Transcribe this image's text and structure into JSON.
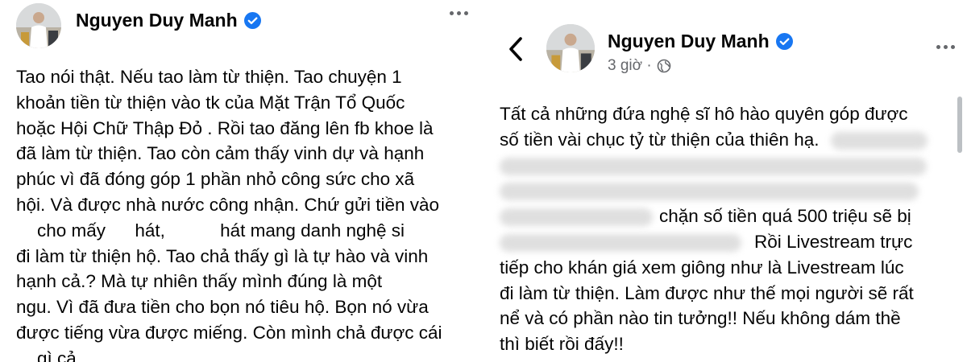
{
  "colors": {
    "verified_blue": "#1877f2",
    "text": "#050505",
    "muted": "#65676b",
    "blur_gray": "#dcdcdc"
  },
  "left_post": {
    "author": "Nguyen Duy Manh",
    "icons": {
      "verified": "verified-badge-icon",
      "more": "more-options-icon"
    },
    "lines": [
      [
        "Tao nói thật. Nếu tao làm từ thiện. Tao chuyện 1"
      ],
      [
        "khoản tiền từ thiện vào tk của Mặt Trận Tổ Quốc"
      ],
      [
        "hoặc Hội Chữ Thập Đỏ . Rồi tao đăng lên fb khoe là"
      ],
      [
        "đã làm từ thiện. Tao còn cảm thấy vinh dự và hạnh"
      ],
      [
        "phúc vì đã đóng góp 1 phần nhỏ công sức cho xã"
      ],
      [
        "hội. Và được nhà nước công nhận. Chứ gửi tiền vào"
      ],
      [
        "cho mấy",
        "hát,",
        "hát mang danh nghệ si"
      ],
      [
        "đi làm từ thiện hộ. Tao chả thấy gì là tự hào và vinh"
      ],
      [
        "hạnh cả.? Mà tự nhiên thấy mình đúng là một"
      ],
      [
        "ngu. Vì đã đưa tiền cho bọn nó tiêu hộ. Bọn nó vừa"
      ],
      [
        "được tiếng vừa được miếng. Còn mình chả được cái"
      ],
      [
        "gì cả"
      ]
    ]
  },
  "right_post": {
    "author": "Nguyen Duy Manh",
    "time": "3 giờ ·",
    "icons": {
      "back": "back-arrow-icon",
      "verified": "verified-badge-icon",
      "globe": "globe-icon",
      "more": "more-options-icon"
    },
    "lines": [
      [
        "Tất cả những đứa nghệ sĩ hô hào quyên góp được"
      ],
      [
        "số tiền vài chục tỷ từ thiện của thiên hạ."
      ],
      [
        ""
      ],
      [
        ""
      ],
      [
        "chặn số tiền quá 500 triệu sẽ bị"
      ],
      [
        "Rồi Livestream trực"
      ],
      [
        "tiếp cho khán giá xem giông như là Livestream lúc"
      ],
      [
        "đi làm từ thiện. Làm được như thế mọi người sẽ rất"
      ],
      [
        "nể và có phần nào tin tưởng!! Nếu không dám thề"
      ],
      [
        "thì biết rồi đấy!!"
      ]
    ]
  }
}
